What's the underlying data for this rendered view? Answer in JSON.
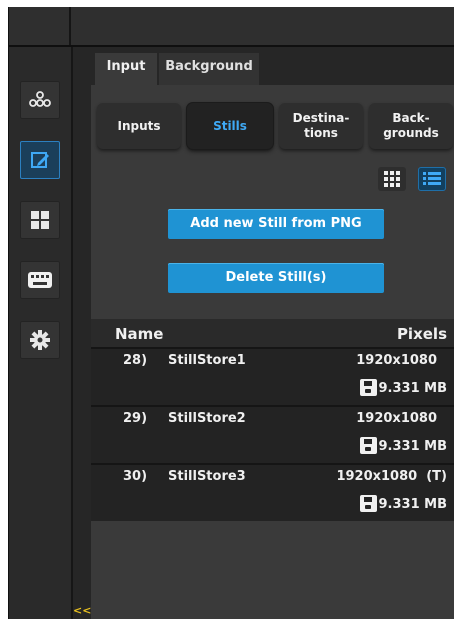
{
  "tabs": [
    {
      "label": "Input",
      "active": true
    },
    {
      "label": "Background",
      "active": false
    }
  ],
  "subtabs": [
    {
      "label": "Inputs",
      "active": false
    },
    {
      "label": "Stills",
      "active": true
    },
    {
      "label": "Destina-\ntions",
      "active": false
    },
    {
      "label": "Back-\ngrounds",
      "active": false
    }
  ],
  "sidebar": {
    "icons": [
      "people-network-icon",
      "edit-icon",
      "multiview-grid-icon",
      "keyboard-icon",
      "gear-icon"
    ],
    "active_index": 1
  },
  "view_toggle": {
    "options": [
      "grid-view-icon",
      "list-view-icon"
    ],
    "selected": "list"
  },
  "actions": {
    "add_label": "Add new Still from PNG",
    "delete_label": "Delete Still(s)"
  },
  "table": {
    "headers": {
      "name": "Name",
      "pixels": "Pixels"
    },
    "rows": [
      {
        "index": "28)",
        "name": "StillStore1",
        "pixels": "1920x1080",
        "size": "9.331 MB"
      },
      {
        "index": "29)",
        "name": "StillStore2",
        "pixels": "1920x1080",
        "size": "9.331 MB"
      },
      {
        "index": "30)",
        "name": "StillStore3",
        "pixels": "1920x1080  (T)",
        "size": "9.331 MB"
      }
    ]
  },
  "collapse_label": "<<",
  "colors": {
    "accent": "#1f93d3",
    "active_text": "#3fa9f5",
    "collapse": "#e8c020"
  }
}
